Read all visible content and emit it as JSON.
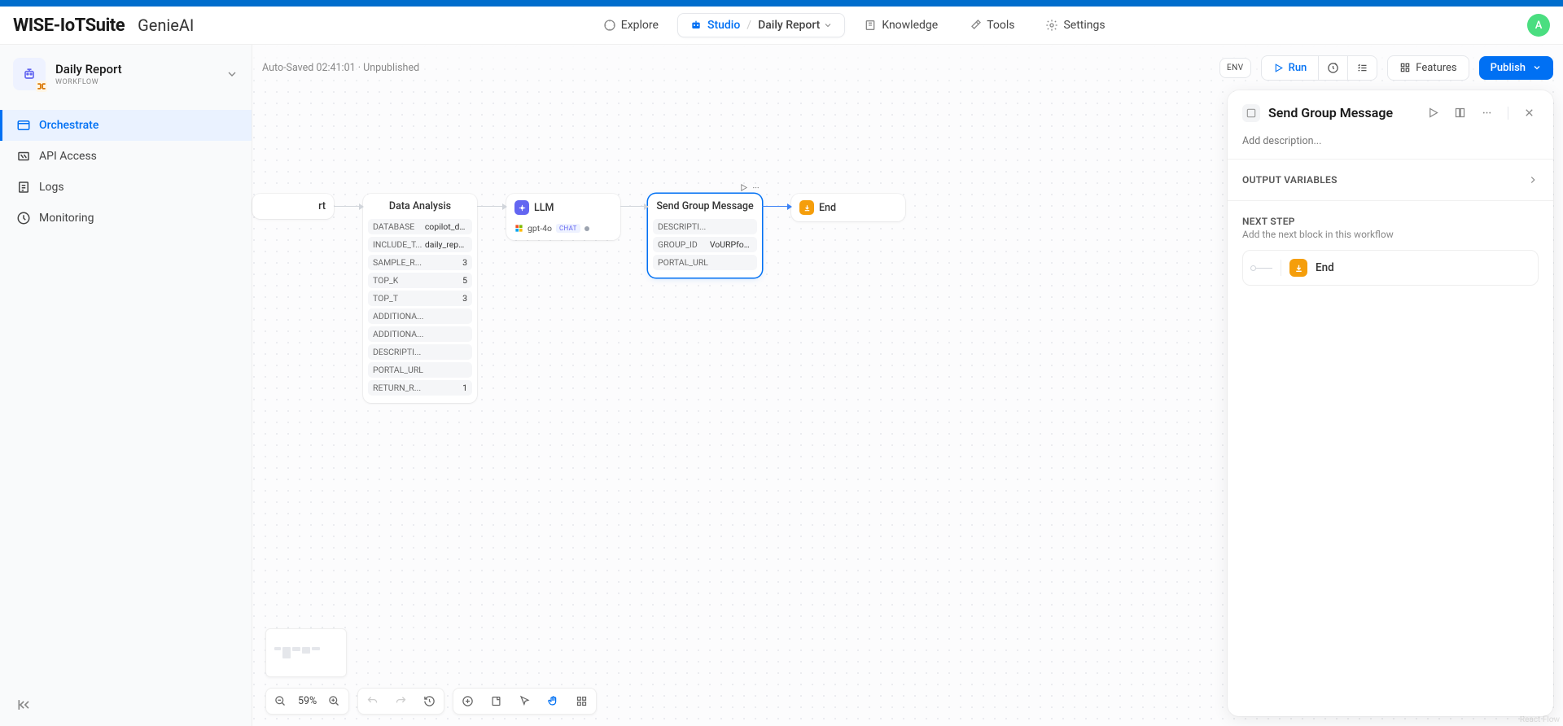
{
  "brand": "WISE-IoTSuite",
  "product": "GenieAI",
  "avatar": "A",
  "nav": {
    "explore": "Explore",
    "studio": "Studio",
    "breadcrumb": "Daily Report",
    "knowledge": "Knowledge",
    "tools": "Tools",
    "settings": "Settings"
  },
  "app": {
    "name": "Daily Report",
    "type": "WORKFLOW"
  },
  "sidebar": {
    "orchestrate": "Orchestrate",
    "api": "API Access",
    "logs": "Logs",
    "monitoring": "Monitoring"
  },
  "status": {
    "saved": "Auto-Saved 02:41:01",
    "published": "Unpublished"
  },
  "toolbar": {
    "env": "ENV",
    "run": "Run",
    "features": "Features",
    "publish": "Publish"
  },
  "nodes": {
    "start": {
      "title": "rt"
    },
    "data": {
      "title": "Data Analysis",
      "rows": [
        {
          "k": "DATABASE",
          "v": "copilot_dev"
        },
        {
          "k": "INCLUDE_T...",
          "v": "daily_report"
        },
        {
          "k": "SAMPLE_R...",
          "v": "3"
        },
        {
          "k": "TOP_K",
          "v": "5"
        },
        {
          "k": "TOP_T",
          "v": "3"
        },
        {
          "k": "ADDITIONA...",
          "v": ""
        },
        {
          "k": "ADDITIONA...",
          "v": ""
        },
        {
          "k": "DESCRIPTI...",
          "v": ""
        },
        {
          "k": "PORTAL_URL",
          "v": ""
        },
        {
          "k": "RETURN_R...",
          "v": "1"
        }
      ]
    },
    "llm": {
      "title": "LLM",
      "model": "gpt-4o",
      "badge": "CHAT"
    },
    "sgm": {
      "title": "Send Group Message",
      "rows": [
        {
          "k": "DESCRIPTI...",
          "v": ""
        },
        {
          "k": "GROUP_ID",
          "v": "VoURPfoNkcug"
        },
        {
          "k": "PORTAL_URL",
          "v": ""
        }
      ]
    },
    "end": {
      "title": "End"
    }
  },
  "zoom": "59%",
  "panel": {
    "title": "Send Group Message",
    "desc_placeholder": "Add description...",
    "output_vars": "OUTPUT VARIABLES",
    "next_step": "NEXT STEP",
    "next_desc": "Add the next block in this workflow",
    "next_block": "End"
  },
  "rf": "React Flow"
}
